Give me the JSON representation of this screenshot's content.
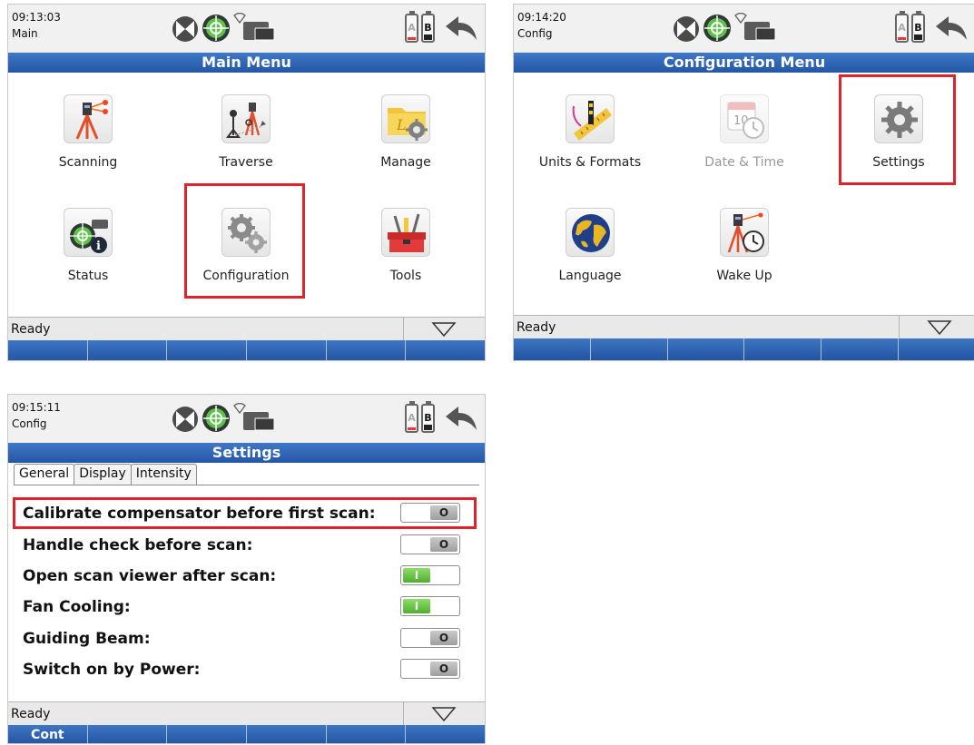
{
  "screens": {
    "main": {
      "time": "09:13:03",
      "mode": "Main",
      "title": "Main Menu",
      "tiles": [
        {
          "label": "Scanning",
          "icon": "scanner-tripod-icon"
        },
        {
          "label": "Traverse",
          "icon": "traverse-icon"
        },
        {
          "label": "Manage",
          "icon": "folder-gear-icon"
        },
        {
          "label": "Status",
          "icon": "status-level-info-icon"
        },
        {
          "label": "Configuration",
          "icon": "gears-icon"
        },
        {
          "label": "Tools",
          "icon": "toolbox-icon"
        }
      ],
      "status": "Ready",
      "softkeys": [
        "",
        "",
        "",
        "",
        "",
        ""
      ]
    },
    "config": {
      "time": "09:14:20",
      "mode": "Config",
      "title": "Configuration Menu",
      "tiles": [
        {
          "label": "Units & Formats",
          "icon": "ruler-level-icon"
        },
        {
          "label": "Date & Time",
          "icon": "calendar-clock-icon",
          "disabled": true
        },
        {
          "label": "Settings",
          "icon": "gear-icon"
        },
        {
          "label": "Language",
          "icon": "globe-icon"
        },
        {
          "label": "Wake Up",
          "icon": "scanner-stopwatch-icon"
        }
      ],
      "status": "Ready",
      "softkeys": [
        "",
        "",
        "",
        "",
        "",
        ""
      ]
    },
    "settings": {
      "time": "09:15:11",
      "mode": "Config",
      "title": "Settings",
      "tabs": [
        "General",
        "Display",
        "Intensity"
      ],
      "active_tab": "General",
      "rows": [
        {
          "label": "Calibrate compensator before first scan:",
          "state": "O",
          "on": false
        },
        {
          "label": "Handle check before scan:",
          "state": "O",
          "on": false
        },
        {
          "label": "Open scan viewer after scan:",
          "state": "I",
          "on": true
        },
        {
          "label": "Fan Cooling:",
          "state": "I",
          "on": true
        },
        {
          "label": "Guiding Beam:",
          "state": "O",
          "on": false
        },
        {
          "label": "Switch on by Power:",
          "state": "O",
          "on": false
        }
      ],
      "status": "Ready",
      "softkeys": [
        "Cont",
        "",
        "",
        "",
        "",
        ""
      ]
    }
  },
  "battery": {
    "a_label": "A",
    "b_label": "B"
  },
  "colors": {
    "title_blue": "#2f66b8",
    "highlight_red": "#e0232a",
    "toggle_on_green": "#5cbf3a"
  }
}
